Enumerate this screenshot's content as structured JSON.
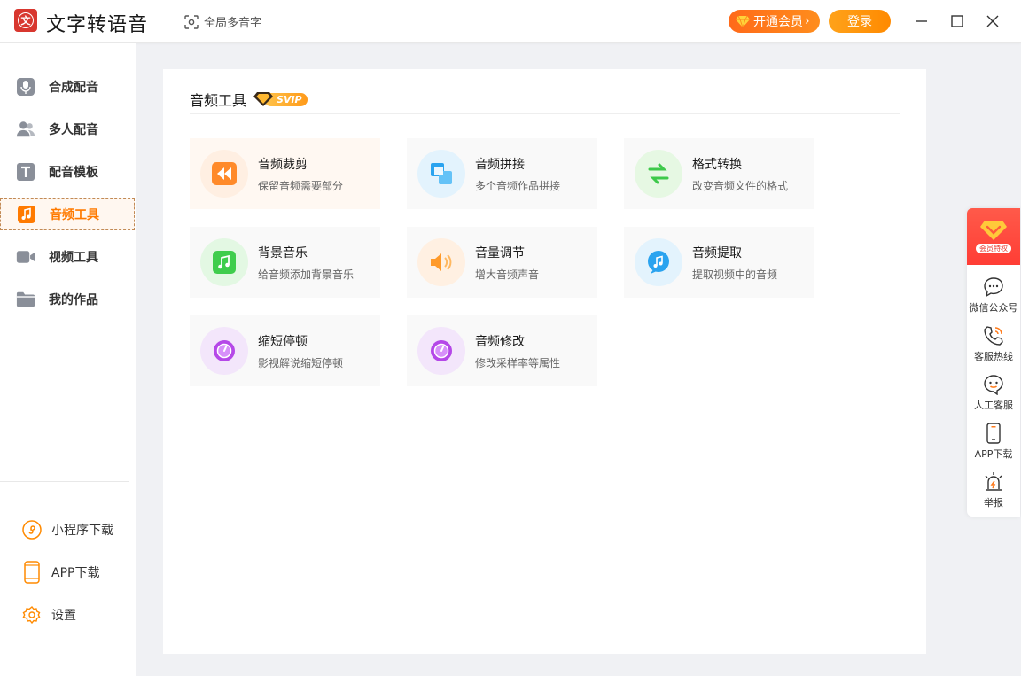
{
  "app": {
    "title": "文字转语音",
    "polyphone_label": "全局多音字",
    "vip_button": "开通会员",
    "vip_arrow": "›",
    "login_button": "登录"
  },
  "sidebar": {
    "items": [
      {
        "label": "合成配音",
        "icon": "microphone-icon"
      },
      {
        "label": "多人配音",
        "icon": "users-icon"
      },
      {
        "label": "配音模板",
        "icon": "template-icon"
      },
      {
        "label": "音频工具",
        "icon": "music-note-icon",
        "active": true
      },
      {
        "label": "视频工具",
        "icon": "video-icon"
      },
      {
        "label": "我的作品",
        "icon": "folder-icon"
      }
    ],
    "bottom": [
      {
        "label": "小程序下载",
        "icon": "mini-program-icon"
      },
      {
        "label": "APP下载",
        "icon": "phone-icon"
      },
      {
        "label": "设置",
        "icon": "gear-icon"
      }
    ]
  },
  "main": {
    "section_title": "音频工具",
    "badge": "SVIP",
    "tools": [
      {
        "name": "音频裁剪",
        "desc": "保留音频需要部分",
        "icon": "rewind-icon"
      },
      {
        "name": "音频拼接",
        "desc": "多个音频作品拼接",
        "icon": "merge-icon"
      },
      {
        "name": "格式转换",
        "desc": "改变音频文件的格式",
        "icon": "swap-arrows-icon"
      },
      {
        "name": "背景音乐",
        "desc": "给音频添加背景音乐",
        "icon": "music-note-icon"
      },
      {
        "name": "音量调节",
        "desc": "增大音频声音",
        "icon": "speaker-icon"
      },
      {
        "name": "音频提取",
        "desc": "提取视频中的音频",
        "icon": "music-bubble-icon"
      },
      {
        "name": "缩短停顿",
        "desc": "影视解说缩短停顿",
        "icon": "dial-icon"
      },
      {
        "name": "音频修改",
        "desc": "修改采样率等属性",
        "icon": "dial-icon"
      }
    ]
  },
  "floatbar": {
    "member_tag": "会员特权",
    "items": [
      {
        "label": "微信公众号",
        "icon": "chat-bubble-icon"
      },
      {
        "label": "客服热线",
        "icon": "phone-call-icon"
      },
      {
        "label": "人工客服",
        "icon": "smile-bubble-icon"
      },
      {
        "label": "APP下载",
        "icon": "mobile-icon"
      },
      {
        "label": "举报",
        "icon": "alarm-icon"
      }
    ]
  },
  "colors": {
    "accent": "#ff7a00",
    "brand_red": "#d8372f",
    "vip_orange": "#ff6a1a"
  }
}
